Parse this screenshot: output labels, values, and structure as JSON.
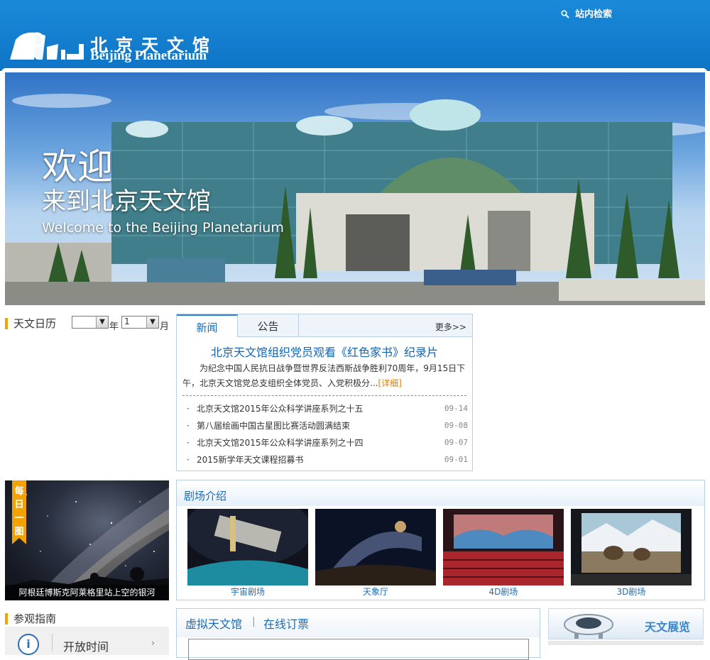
{
  "header": {
    "search_label": "站内检索",
    "logo_cn": "北京天文馆",
    "logo_en": "Beijing Planetarium"
  },
  "banner": {
    "line1": "欢迎",
    "line2": "来到北京天文馆",
    "line3": "Welcome to the Beijing Planetarium"
  },
  "calendar": {
    "title": "天文日历",
    "year_value": "",
    "year_unit": "年",
    "month_value": "1",
    "month_unit": "月"
  },
  "news": {
    "tabs": [
      "新闻",
      "公告"
    ],
    "more": "更多>>",
    "headline": "北京天文馆组织党员观看《红色家书》纪录片",
    "summary": "为纪念中国人民抗日战争暨世界反法西斯战争胜利70周年，9月15日下午，北京天文馆党总支组织全体党员、入党积极分...",
    "detail": "[详细]",
    "items": [
      {
        "title": "北京天文馆2015年公众科学讲座系列之十五",
        "date": "09-14"
      },
      {
        "title": "第八届绘画中国古星图比赛活动圆满结束",
        "date": "09-08"
      },
      {
        "title": "北京天文馆2015年公众科学讲座系列之十四",
        "date": "09-07"
      },
      {
        "title": "2015新学年天文课程招募书",
        "date": "09-01"
      }
    ]
  },
  "daily": {
    "badge": "每日一图",
    "caption": "阿根廷博斯克阿莱格里站上空的银河"
  },
  "theaters": {
    "title": "剧场介绍",
    "items": [
      "宇宙剧场",
      "天象厅",
      "4D剧场",
      "3D剧场"
    ]
  },
  "guide": {
    "title": "参观指南",
    "item": "开放时间"
  },
  "virtual": {
    "tab1": "虚拟天文馆",
    "sep": "|",
    "tab2": "在线订票"
  },
  "exhibit": {
    "title": "天文展览"
  },
  "colors": {
    "header_blue": "#1a8ad8",
    "link_blue": "#1a6cb6",
    "accent_orange": "#f3a300"
  }
}
